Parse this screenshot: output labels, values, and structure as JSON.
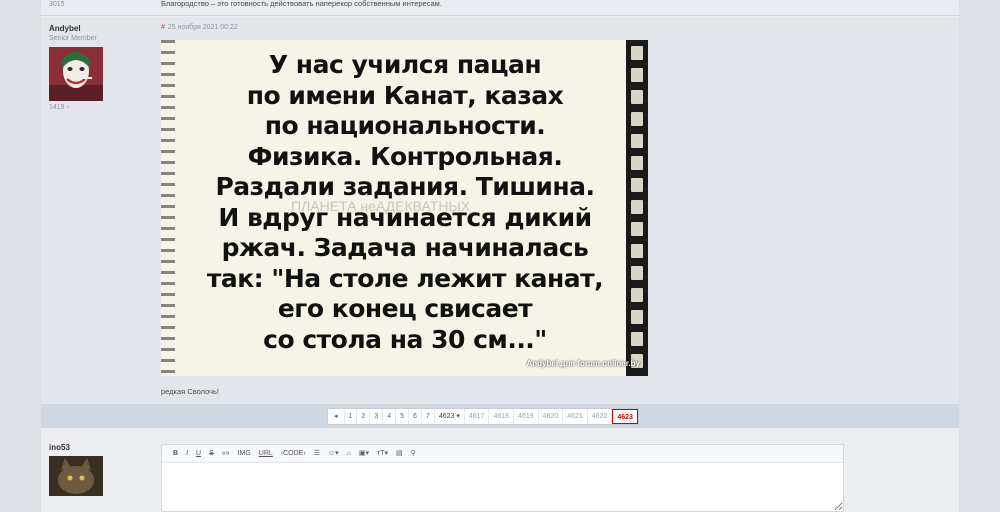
{
  "prev_post": {
    "count": "3015",
    "signature": "Благородство – это готовность действовать наперекор собственным интересам."
  },
  "post": {
    "author": "Andybel",
    "rank": "Senior Member",
    "post_count": "1419",
    "date": "25 ноября 2021 00:22",
    "date_hash": "#",
    "meme_lines": [
      "У нас учился пацан",
      "по имени Канат, казах",
      "по национальности.",
      "Физика. Контрольная.",
      "Раздали задания. Тишина.",
      "И вдруг начинается дикий",
      "ржач. Задача начиналась",
      "так: \"На столе лежит канат,",
      "его конец свисает",
      "со стола на 30 см...\""
    ],
    "watermark": "ПЛАНЕТА неАДЕКВАТНЫХ",
    "credit": "Andybel для forum.onliner.by",
    "caption": "редкая Сволочь!"
  },
  "pager": {
    "prev": "◂",
    "pages": [
      "1",
      "2",
      "3",
      "4",
      "5",
      "6",
      "7"
    ],
    "dropdown": "4623 ▾",
    "recent": [
      "4617",
      "4618",
      "4619",
      "4620",
      "4621",
      "4622"
    ],
    "current": "4623"
  },
  "reply": {
    "author": "ino53",
    "toolbar": {
      "bold": "B",
      "italic": "I",
      "underline": "U",
      "strike": "S",
      "quote": "«»",
      "img": "IMG",
      "url": "URL",
      "code": "‹CODE›",
      "list": "☰",
      "smile": "☺▾",
      "spoiler": "⌂",
      "color": "▣▾",
      "size": "тT▾",
      "media": "▤",
      "map": "⚲"
    }
  },
  "colors": {
    "accent": "#3a6fb0",
    "current_page": "#cc0000"
  }
}
